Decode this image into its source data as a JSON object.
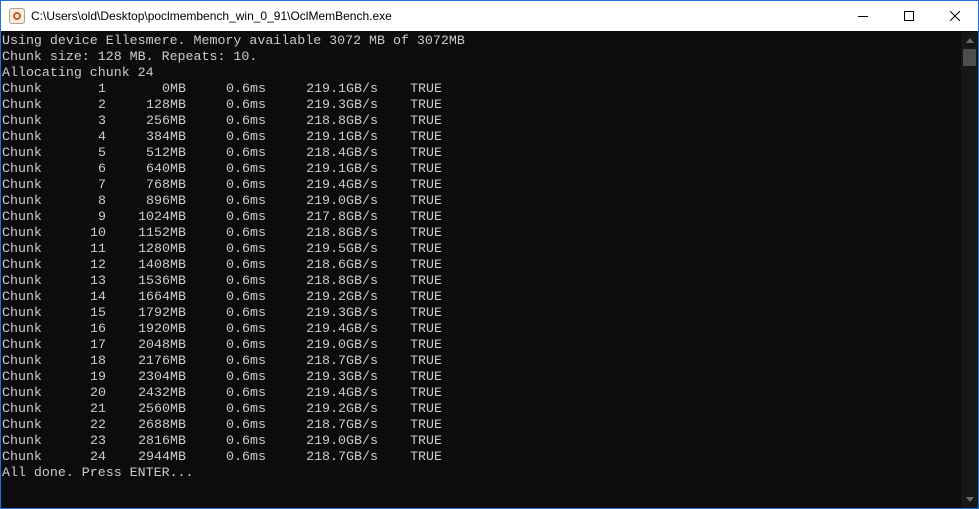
{
  "window": {
    "title": "C:\\Users\\old\\Desktop\\poclmembench_win_0_91\\OclMemBench.exe",
    "icon": "app-icon",
    "controls": [
      "minimize-icon",
      "maximize-icon",
      "close-icon"
    ]
  },
  "console": {
    "header": [
      "Using device Ellesmere. Memory available 3072 MB of 3072MB",
      "Chunk size: 128 MB. Repeats: 10.",
      "Allocating chunk 24"
    ],
    "rows": [
      {
        "label": "Chunk",
        "idx": "1",
        "mb": "0",
        "unit1": "MB",
        "ms": "0.6",
        "unit2": "ms",
        "gbs": "219.1",
        "unit3": "GB/s",
        "ok": "TRUE"
      },
      {
        "label": "Chunk",
        "idx": "2",
        "mb": "128",
        "unit1": "MB",
        "ms": "0.6",
        "unit2": "ms",
        "gbs": "219.3",
        "unit3": "GB/s",
        "ok": "TRUE"
      },
      {
        "label": "Chunk",
        "idx": "3",
        "mb": "256",
        "unit1": "MB",
        "ms": "0.6",
        "unit2": "ms",
        "gbs": "218.8",
        "unit3": "GB/s",
        "ok": "TRUE"
      },
      {
        "label": "Chunk",
        "idx": "4",
        "mb": "384",
        "unit1": "MB",
        "ms": "0.6",
        "unit2": "ms",
        "gbs": "219.1",
        "unit3": "GB/s",
        "ok": "TRUE"
      },
      {
        "label": "Chunk",
        "idx": "5",
        "mb": "512",
        "unit1": "MB",
        "ms": "0.6",
        "unit2": "ms",
        "gbs": "218.4",
        "unit3": "GB/s",
        "ok": "TRUE"
      },
      {
        "label": "Chunk",
        "idx": "6",
        "mb": "640",
        "unit1": "MB",
        "ms": "0.6",
        "unit2": "ms",
        "gbs": "219.1",
        "unit3": "GB/s",
        "ok": "TRUE"
      },
      {
        "label": "Chunk",
        "idx": "7",
        "mb": "768",
        "unit1": "MB",
        "ms": "0.6",
        "unit2": "ms",
        "gbs": "219.4",
        "unit3": "GB/s",
        "ok": "TRUE"
      },
      {
        "label": "Chunk",
        "idx": "8",
        "mb": "896",
        "unit1": "MB",
        "ms": "0.6",
        "unit2": "ms",
        "gbs": "219.0",
        "unit3": "GB/s",
        "ok": "TRUE"
      },
      {
        "label": "Chunk",
        "idx": "9",
        "mb": "1024",
        "unit1": "MB",
        "ms": "0.6",
        "unit2": "ms",
        "gbs": "217.8",
        "unit3": "GB/s",
        "ok": "TRUE"
      },
      {
        "label": "Chunk",
        "idx": "10",
        "mb": "1152",
        "unit1": "MB",
        "ms": "0.6",
        "unit2": "ms",
        "gbs": "218.8",
        "unit3": "GB/s",
        "ok": "TRUE"
      },
      {
        "label": "Chunk",
        "idx": "11",
        "mb": "1280",
        "unit1": "MB",
        "ms": "0.6",
        "unit2": "ms",
        "gbs": "219.5",
        "unit3": "GB/s",
        "ok": "TRUE"
      },
      {
        "label": "Chunk",
        "idx": "12",
        "mb": "1408",
        "unit1": "MB",
        "ms": "0.6",
        "unit2": "ms",
        "gbs": "218.6",
        "unit3": "GB/s",
        "ok": "TRUE"
      },
      {
        "label": "Chunk",
        "idx": "13",
        "mb": "1536",
        "unit1": "MB",
        "ms": "0.6",
        "unit2": "ms",
        "gbs": "218.8",
        "unit3": "GB/s",
        "ok": "TRUE"
      },
      {
        "label": "Chunk",
        "idx": "14",
        "mb": "1664",
        "unit1": "MB",
        "ms": "0.6",
        "unit2": "ms",
        "gbs": "219.2",
        "unit3": "GB/s",
        "ok": "TRUE"
      },
      {
        "label": "Chunk",
        "idx": "15",
        "mb": "1792",
        "unit1": "MB",
        "ms": "0.6",
        "unit2": "ms",
        "gbs": "219.3",
        "unit3": "GB/s",
        "ok": "TRUE"
      },
      {
        "label": "Chunk",
        "idx": "16",
        "mb": "1920",
        "unit1": "MB",
        "ms": "0.6",
        "unit2": "ms",
        "gbs": "219.4",
        "unit3": "GB/s",
        "ok": "TRUE"
      },
      {
        "label": "Chunk",
        "idx": "17",
        "mb": "2048",
        "unit1": "MB",
        "ms": "0.6",
        "unit2": "ms",
        "gbs": "219.0",
        "unit3": "GB/s",
        "ok": "TRUE"
      },
      {
        "label": "Chunk",
        "idx": "18",
        "mb": "2176",
        "unit1": "MB",
        "ms": "0.6",
        "unit2": "ms",
        "gbs": "218.7",
        "unit3": "GB/s",
        "ok": "TRUE"
      },
      {
        "label": "Chunk",
        "idx": "19",
        "mb": "2304",
        "unit1": "MB",
        "ms": "0.6",
        "unit2": "ms",
        "gbs": "219.3",
        "unit3": "GB/s",
        "ok": "TRUE"
      },
      {
        "label": "Chunk",
        "idx": "20",
        "mb": "2432",
        "unit1": "MB",
        "ms": "0.6",
        "unit2": "ms",
        "gbs": "219.4",
        "unit3": "GB/s",
        "ok": "TRUE"
      },
      {
        "label": "Chunk",
        "idx": "21",
        "mb": "2560",
        "unit1": "MB",
        "ms": "0.6",
        "unit2": "ms",
        "gbs": "219.2",
        "unit3": "GB/s",
        "ok": "TRUE"
      },
      {
        "label": "Chunk",
        "idx": "22",
        "mb": "2688",
        "unit1": "MB",
        "ms": "0.6",
        "unit2": "ms",
        "gbs": "218.7",
        "unit3": "GB/s",
        "ok": "TRUE"
      },
      {
        "label": "Chunk",
        "idx": "23",
        "mb": "2816",
        "unit1": "MB",
        "ms": "0.6",
        "unit2": "ms",
        "gbs": "219.0",
        "unit3": "GB/s",
        "ok": "TRUE"
      },
      {
        "label": "Chunk",
        "idx": "24",
        "mb": "2944",
        "unit1": "MB",
        "ms": "0.6",
        "unit2": "ms",
        "gbs": "218.7",
        "unit3": "GB/s",
        "ok": "TRUE"
      }
    ],
    "footer": "All done. Press ENTER..."
  },
  "colors": {
    "console_bg": "#0c0c0c",
    "console_text": "#cccccc",
    "titlebar_bg": "#ffffff",
    "window_border": "#1f71d8"
  },
  "scrollbar": {
    "icons": [
      "scroll-up-arrow-icon",
      "scroll-down-arrow-icon"
    ]
  }
}
